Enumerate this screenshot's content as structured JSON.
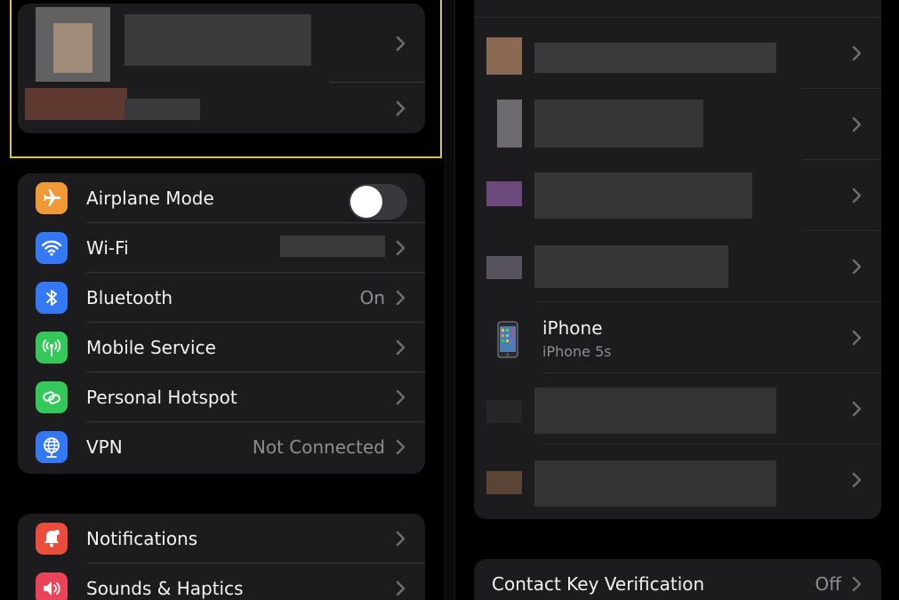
{
  "settings": {
    "items": [
      {
        "label": "Airplane Mode",
        "value": "",
        "icon": "airplane-icon",
        "color": "#f09a37",
        "toggle": false
      },
      {
        "label": "Wi-Fi",
        "value": "",
        "icon": "wifi-icon",
        "color": "#3478f6"
      },
      {
        "label": "Bluetooth",
        "value": "On",
        "icon": "bluetooth-icon",
        "color": "#3478f6"
      },
      {
        "label": "Mobile Service",
        "value": "",
        "icon": "antenna-icon",
        "color": "#34c759"
      },
      {
        "label": "Personal Hotspot",
        "value": "",
        "icon": "hotspot-icon",
        "color": "#34c759"
      },
      {
        "label": "VPN",
        "value": "Not Connected",
        "icon": "globe-icon",
        "color": "#3478f6"
      }
    ],
    "items2": [
      {
        "label": "Notifications",
        "icon": "bell-icon",
        "color": "#eb4d3d"
      },
      {
        "label": "Sounds & Haptics",
        "icon": "speaker-icon",
        "color": "#eb445a"
      }
    ]
  },
  "devices": {
    "iphone_name": "iPhone",
    "iphone_model": "iPhone 5s"
  },
  "contact_key": {
    "label": "Contact Key Verification",
    "value": "Off"
  },
  "colors": {
    "background": "#000000",
    "group": "#1c1c1e",
    "highlight": "#d9c82a"
  }
}
